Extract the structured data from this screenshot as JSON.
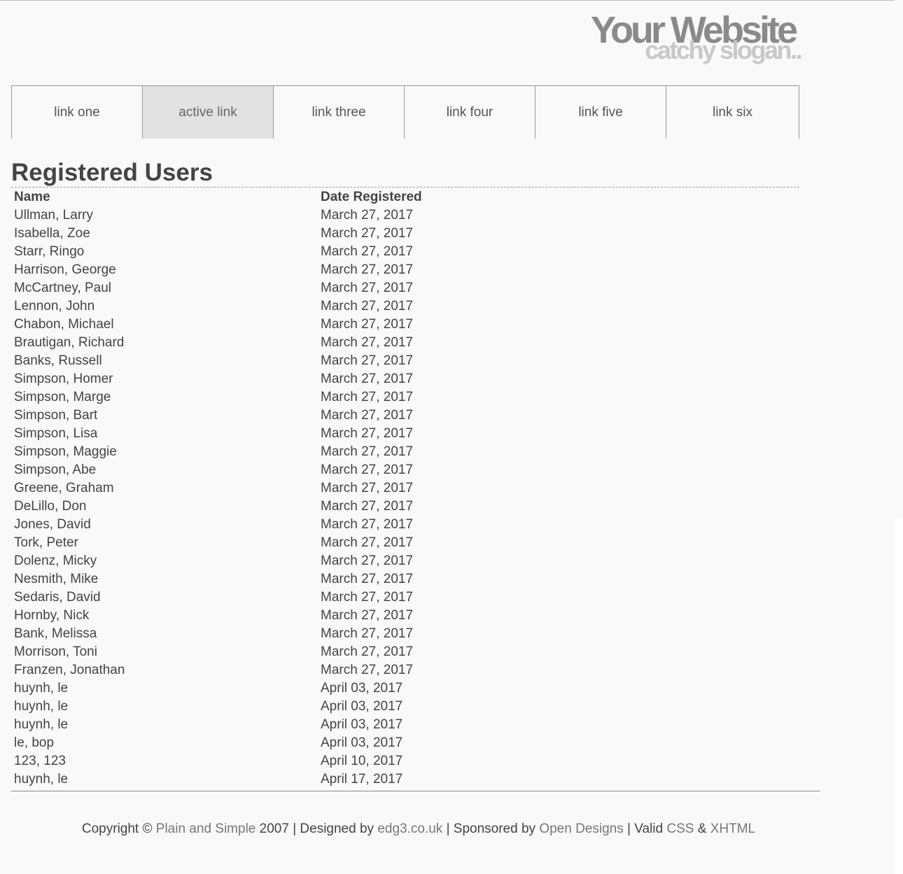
{
  "logo": {
    "title": "Your Website",
    "slogan": "catchy slogan.."
  },
  "nav": [
    {
      "label": "link one",
      "active": false
    },
    {
      "label": "active link",
      "active": true
    },
    {
      "label": "link three",
      "active": false
    },
    {
      "label": "link four",
      "active": false
    },
    {
      "label": "link five",
      "active": false
    },
    {
      "label": "link six",
      "active": false
    }
  ],
  "main": {
    "heading": "Registered Users",
    "columns": [
      "Name",
      "Date Registered"
    ],
    "rows": [
      [
        "Ullman, Larry",
        "March 27, 2017"
      ],
      [
        "Isabella, Zoe",
        "March 27, 2017"
      ],
      [
        "Starr, Ringo",
        "March 27, 2017"
      ],
      [
        "Harrison, George",
        "March 27, 2017"
      ],
      [
        "McCartney, Paul",
        "March 27, 2017"
      ],
      [
        "Lennon, John",
        "March 27, 2017"
      ],
      [
        "Chabon, Michael",
        "March 27, 2017"
      ],
      [
        "Brautigan, Richard",
        "March 27, 2017"
      ],
      [
        "Banks, Russell",
        "March 27, 2017"
      ],
      [
        "Simpson, Homer",
        "March 27, 2017"
      ],
      [
        "Simpson, Marge",
        "March 27, 2017"
      ],
      [
        "Simpson, Bart",
        "March 27, 2017"
      ],
      [
        "Simpson, Lisa",
        "March 27, 2017"
      ],
      [
        "Simpson, Maggie",
        "March 27, 2017"
      ],
      [
        "Simpson, Abe",
        "March 27, 2017"
      ],
      [
        "Greene, Graham",
        "March 27, 2017"
      ],
      [
        "DeLillo, Don",
        "March 27, 2017"
      ],
      [
        "Jones, David",
        "March 27, 2017"
      ],
      [
        "Tork, Peter",
        "March 27, 2017"
      ],
      [
        "Dolenz, Micky",
        "March 27, 2017"
      ],
      [
        "Nesmith, Mike",
        "March 27, 2017"
      ],
      [
        "Sedaris, David",
        "March 27, 2017"
      ],
      [
        "Hornby, Nick",
        "March 27, 2017"
      ],
      [
        "Bank, Melissa",
        "March 27, 2017"
      ],
      [
        "Morrison, Toni",
        "March 27, 2017"
      ],
      [
        "Franzen, Jonathan",
        "March 27, 2017"
      ],
      [
        "huynh, le",
        "April 03, 2017"
      ],
      [
        "huynh, le",
        "April 03, 2017"
      ],
      [
        "huynh, le",
        "April 03, 2017"
      ],
      [
        "le, bop",
        "April 03, 2017"
      ],
      [
        "123, 123",
        "April 10, 2017"
      ],
      [
        "huynh, le",
        "April 17, 2017"
      ]
    ]
  },
  "footer": {
    "copyright_prefix": "Copyright ©",
    "plain_simple_link": "Plain and Simple",
    "year_designed": "2007 | Designed by",
    "designer_link": "edg3.co.uk",
    "sponsored_text": "| Sponsored by",
    "sponsor_link": "Open Designs",
    "valid_text": "| Valid",
    "css_link": "CSS",
    "amp": "&",
    "xhtml_link": "XHTML"
  }
}
